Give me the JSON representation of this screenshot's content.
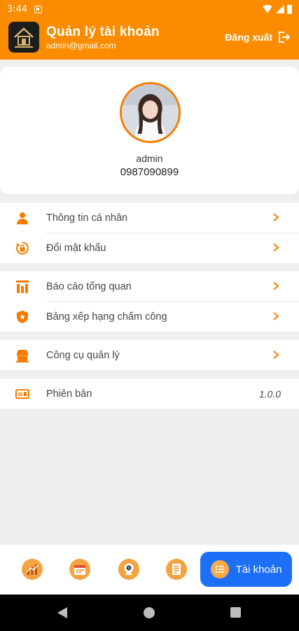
{
  "status_bar": {
    "time": "3:44"
  },
  "header": {
    "title": "Quản lý tài khoản",
    "email": "admin@gmail.com",
    "logout_label": "Đăng xuất"
  },
  "profile": {
    "name": "admin",
    "phone": "0987090899"
  },
  "menu_groups": [
    {
      "items": [
        {
          "label": "Thông tin cá nhân",
          "icon": "person-icon"
        },
        {
          "label": "Đổi mật khẩu",
          "icon": "lock-reset-icon"
        }
      ]
    },
    {
      "items": [
        {
          "label": "Báo cáo tổng quan",
          "icon": "report-icon"
        },
        {
          "label": "Bảng xếp hạng chấm công",
          "icon": "shield-star-icon"
        }
      ]
    },
    {
      "items": [
        {
          "label": "Công cụ quản lý",
          "icon": "store-icon"
        }
      ]
    },
    {
      "items": [
        {
          "label": "Phiên bản",
          "icon": "version-icon",
          "value": "1.0.0"
        }
      ]
    }
  ],
  "bottom_nav": {
    "items": [
      "chart-icon",
      "calendar-icon",
      "webcam-icon",
      "document-icon"
    ],
    "active_label": "Tài khoản"
  },
  "colors": {
    "accent": "#fb8c00",
    "active_tab": "#1e6ff8",
    "icon": "#f57c00"
  }
}
